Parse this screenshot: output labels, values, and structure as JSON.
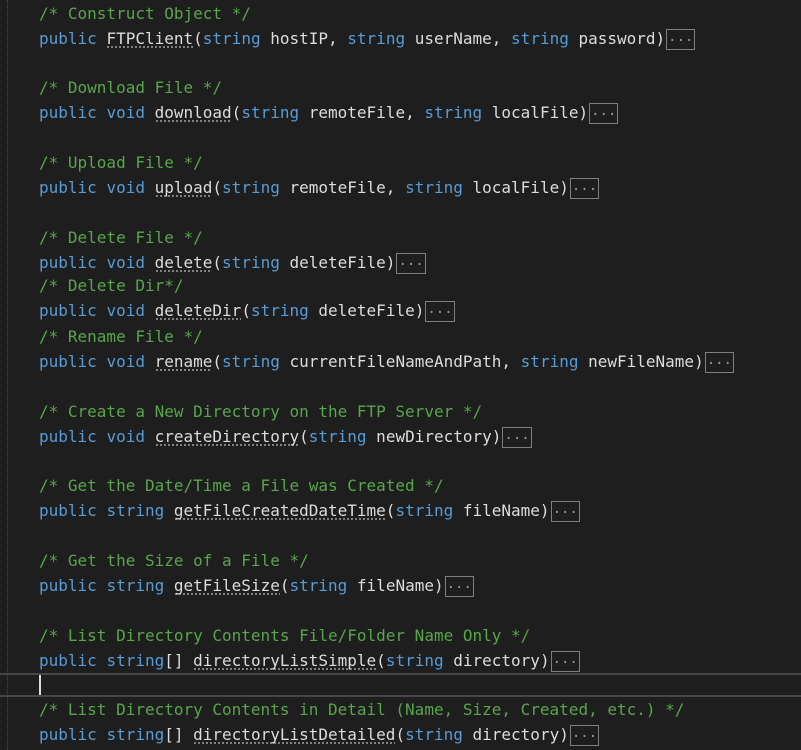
{
  "blocks": [
    {
      "comment": "/* Construct Object */",
      "sig": [
        {
          "t": "kw",
          "v": "public"
        },
        {
          "t": "p",
          "v": " "
        },
        {
          "t": "id",
          "v": "FTPClient"
        },
        {
          "t": "p",
          "v": "("
        },
        {
          "t": "kw",
          "v": "string"
        },
        {
          "t": "p",
          "v": " hostIP, "
        },
        {
          "t": "kw",
          "v": "string"
        },
        {
          "t": "p",
          "v": " userName, "
        },
        {
          "t": "kw",
          "v": "string"
        },
        {
          "t": "p",
          "v": " password)"
        }
      ],
      "collapsed": "..."
    },
    {
      "comment": "/* Download File */",
      "sig": [
        {
          "t": "kw",
          "v": "public"
        },
        {
          "t": "p",
          "v": " "
        },
        {
          "t": "kw",
          "v": "void"
        },
        {
          "t": "p",
          "v": " "
        },
        {
          "t": "id",
          "v": "download"
        },
        {
          "t": "p",
          "v": "("
        },
        {
          "t": "kw",
          "v": "string"
        },
        {
          "t": "p",
          "v": " remoteFile, "
        },
        {
          "t": "kw",
          "v": "string"
        },
        {
          "t": "p",
          "v": " localFile)"
        }
      ],
      "collapsed": "..."
    },
    {
      "comment": "/* Upload File */",
      "sig": [
        {
          "t": "kw",
          "v": "public"
        },
        {
          "t": "p",
          "v": " "
        },
        {
          "t": "kw",
          "v": "void"
        },
        {
          "t": "p",
          "v": " "
        },
        {
          "t": "id",
          "v": "upload"
        },
        {
          "t": "p",
          "v": "("
        },
        {
          "t": "kw",
          "v": "string"
        },
        {
          "t": "p",
          "v": " remoteFile, "
        },
        {
          "t": "kw",
          "v": "string"
        },
        {
          "t": "p",
          "v": " localFile)"
        }
      ],
      "collapsed": "..."
    },
    {
      "comment": "/* Delete File */",
      "sig": [
        {
          "t": "kw",
          "v": "public"
        },
        {
          "t": "p",
          "v": " "
        },
        {
          "t": "kw",
          "v": "void"
        },
        {
          "t": "p",
          "v": " "
        },
        {
          "t": "id",
          "v": "delete"
        },
        {
          "t": "p",
          "v": "("
        },
        {
          "t": "kw",
          "v": "string"
        },
        {
          "t": "p",
          "v": " deleteFile)"
        }
      ],
      "collapsed": "..."
    },
    {
      "comment": "/* Delete Dir*/",
      "sig": [
        {
          "t": "kw",
          "v": "public"
        },
        {
          "t": "p",
          "v": " "
        },
        {
          "t": "kw",
          "v": "void"
        },
        {
          "t": "p",
          "v": " "
        },
        {
          "t": "id",
          "v": "deleteDir"
        },
        {
          "t": "p",
          "v": "("
        },
        {
          "t": "kw",
          "v": "string"
        },
        {
          "t": "p",
          "v": " deleteFile)"
        }
      ],
      "collapsed": "..."
    },
    {
      "comment": "/* Rename File */",
      "sig": [
        {
          "t": "kw",
          "v": "public"
        },
        {
          "t": "p",
          "v": " "
        },
        {
          "t": "kw",
          "v": "void"
        },
        {
          "t": "p",
          "v": " "
        },
        {
          "t": "id",
          "v": "rename"
        },
        {
          "t": "p",
          "v": "("
        },
        {
          "t": "kw",
          "v": "string"
        },
        {
          "t": "p",
          "v": " currentFileNameAndPath, "
        },
        {
          "t": "kw",
          "v": "string"
        },
        {
          "t": "p",
          "v": " newFileName)"
        }
      ],
      "collapsed": "..."
    },
    {
      "comment": "/* Create a New Directory on the FTP Server */",
      "sig": [
        {
          "t": "kw",
          "v": "public"
        },
        {
          "t": "p",
          "v": " "
        },
        {
          "t": "kw",
          "v": "void"
        },
        {
          "t": "p",
          "v": " "
        },
        {
          "t": "id",
          "v": "createDirectory"
        },
        {
          "t": "p",
          "v": "("
        },
        {
          "t": "kw",
          "v": "string"
        },
        {
          "t": "p",
          "v": " newDirectory)"
        }
      ],
      "collapsed": "..."
    },
    {
      "comment": "/* Get the Date/Time a File was Created */",
      "sig": [
        {
          "t": "kw",
          "v": "public"
        },
        {
          "t": "p",
          "v": " "
        },
        {
          "t": "kw",
          "v": "string"
        },
        {
          "t": "p",
          "v": " "
        },
        {
          "t": "id",
          "v": "getFileCreatedDateTime"
        },
        {
          "t": "p",
          "v": "("
        },
        {
          "t": "kw",
          "v": "string"
        },
        {
          "t": "p",
          "v": " fileName)"
        }
      ],
      "collapsed": "..."
    },
    {
      "comment": "/* Get the Size of a File */",
      "sig": [
        {
          "t": "kw",
          "v": "public"
        },
        {
          "t": "p",
          "v": " "
        },
        {
          "t": "kw",
          "v": "string"
        },
        {
          "t": "p",
          "v": " "
        },
        {
          "t": "id",
          "v": "getFileSize"
        },
        {
          "t": "p",
          "v": "("
        },
        {
          "t": "kw",
          "v": "string"
        },
        {
          "t": "p",
          "v": " fileName)"
        }
      ],
      "collapsed": "..."
    },
    {
      "comment": "/* List Directory Contents File/Folder Name Only */",
      "sig": [
        {
          "t": "kw",
          "v": "public"
        },
        {
          "t": "p",
          "v": " "
        },
        {
          "t": "kw",
          "v": "string"
        },
        {
          "t": "p",
          "v": "[] "
        },
        {
          "t": "id",
          "v": "directoryListSimple"
        },
        {
          "t": "p",
          "v": "("
        },
        {
          "t": "kw",
          "v": "string"
        },
        {
          "t": "p",
          "v": " directory)"
        }
      ],
      "collapsed": "..."
    },
    {
      "comment": "/* List Directory Contents in Detail (Name, Size, Created, etc.) */",
      "sig": [
        {
          "t": "kw",
          "v": "public"
        },
        {
          "t": "p",
          "v": " "
        },
        {
          "t": "kw",
          "v": "string"
        },
        {
          "t": "p",
          "v": "[] "
        },
        {
          "t": "id",
          "v": "directoryListDetailed"
        },
        {
          "t": "p",
          "v": "("
        },
        {
          "t": "kw",
          "v": "string"
        },
        {
          "t": "p",
          "v": " directory)"
        }
      ],
      "collapsed": "..."
    }
  ],
  "colors": {
    "background": "#1e1e1e",
    "comment": "#57a64a",
    "keyword": "#569cd6",
    "identifier": "#dcdcdc"
  }
}
